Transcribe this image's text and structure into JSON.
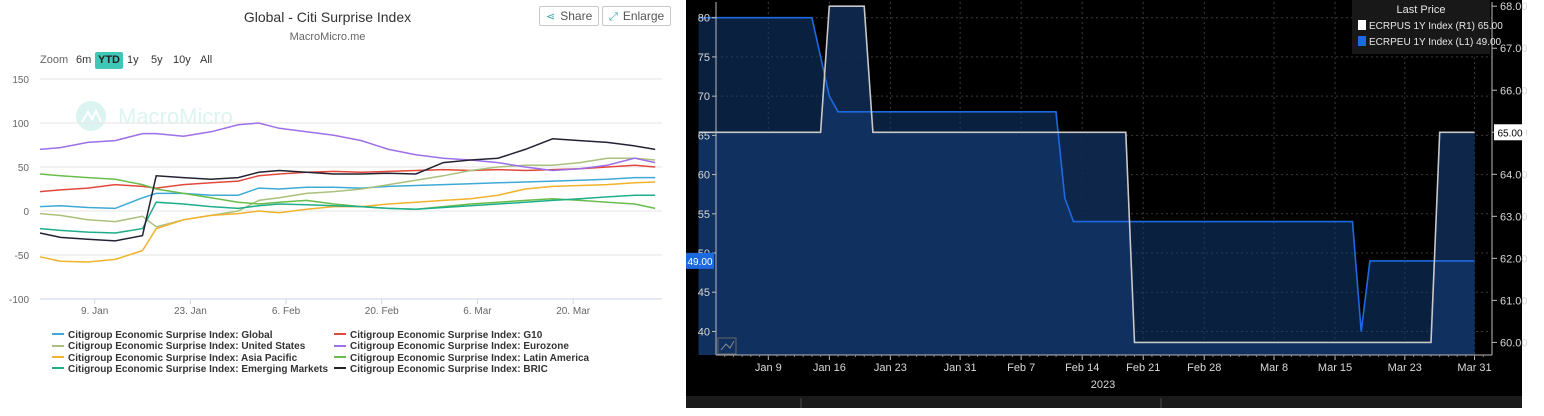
{
  "left_chart": {
    "title": "Global - Citi Surprise Index",
    "subtitle": "MacroMicro.me",
    "watermark": "MacroMicro",
    "share_label": "Share",
    "enlarge_label": "Enlarge",
    "zoom_label": "Zoom",
    "zoom_options": [
      "6m",
      "YTD",
      "1y",
      "5y",
      "10y",
      "All"
    ],
    "zoom_selected": "YTD"
  },
  "right_chart": {
    "legend_header": "Last Price",
    "year_label": "2023",
    "left_badge": "49.00",
    "right_badge": "65.00"
  },
  "chart_data": [
    {
      "type": "line",
      "title": "Global - Citi Surprise Index",
      "x_type": "date",
      "x_ticks": [
        "9. Jan",
        "23. Jan",
        "6. Feb",
        "20. Feb",
        "6. Mar",
        "20. Mar"
      ],
      "x_tick_days": [
        9,
        23,
        37,
        51,
        65,
        79
      ],
      "ylim": [
        -100,
        150
      ],
      "y_ticks": [
        -100,
        -50,
        0,
        50,
        100,
        150
      ],
      "grid": true,
      "legend_position": "bottom",
      "x": [
        1,
        4,
        8,
        12,
        16,
        18,
        22,
        26,
        30,
        33,
        36,
        40,
        44,
        48,
        52,
        56,
        60,
        64,
        68,
        72,
        76,
        80,
        84,
        88,
        91
      ],
      "series": [
        {
          "name": "Citigroup Economic Surprise Index: Global",
          "color": "#3fa9d6",
          "values": [
            5,
            6,
            4,
            3,
            15,
            20,
            20,
            18,
            18,
            26,
            25,
            27,
            27,
            26,
            28,
            29,
            30,
            31,
            32,
            33,
            34,
            35,
            36,
            38,
            38
          ]
        },
        {
          "name": "Citigroup Economic Surprise Index: G10",
          "color": "#e2483b",
          "values": [
            22,
            24,
            26,
            30,
            28,
            26,
            30,
            32,
            34,
            40,
            42,
            44,
            45,
            44,
            45,
            46,
            47,
            46,
            47,
            46,
            47,
            48,
            50,
            52,
            50
          ]
        },
        {
          "name": "Citigroup Economic Surprise Index: United States",
          "color": "#aac07d",
          "values": [
            -3,
            -5,
            -10,
            -12,
            -6,
            -18,
            -10,
            -5,
            0,
            12,
            15,
            20,
            22,
            25,
            30,
            35,
            40,
            46,
            50,
            52,
            52,
            55,
            60,
            60,
            58
          ]
        },
        {
          "name": "Citigroup Economic Surprise Index: Eurozone",
          "color": "#9d6fe8",
          "values": [
            70,
            72,
            78,
            80,
            88,
            88,
            85,
            90,
            98,
            100,
            94,
            90,
            86,
            80,
            70,
            64,
            60,
            58,
            55,
            50,
            46,
            48,
            52,
            60,
            55
          ]
        },
        {
          "name": "Citigroup Economic Surprise Index: Asia Pacific",
          "color": "#f1b22c",
          "values": [
            -52,
            -57,
            -58,
            -55,
            -45,
            -20,
            -10,
            -5,
            -3,
            0,
            -2,
            2,
            5,
            5,
            8,
            10,
            12,
            14,
            18,
            25,
            28,
            29,
            30,
            32,
            33
          ]
        },
        {
          "name": "Citigroup Economic Surprise Index: Latin America",
          "color": "#69bd4a",
          "values": [
            42,
            40,
            38,
            36,
            30,
            25,
            20,
            15,
            10,
            8,
            10,
            12,
            8,
            5,
            3,
            2,
            5,
            8,
            10,
            12,
            14,
            12,
            10,
            8,
            3
          ]
        },
        {
          "name": "Citigroup Economic Surprise Index: Emerging Markets",
          "color": "#1fae8c",
          "values": [
            -20,
            -22,
            -24,
            -25,
            -20,
            10,
            8,
            5,
            3,
            6,
            8,
            7,
            6,
            5,
            3,
            2,
            4,
            6,
            8,
            10,
            12,
            14,
            16,
            18,
            18
          ]
        },
        {
          "name": "Citigroup Economic Surprise Index: BRIC",
          "color": "#222233",
          "values": [
            -25,
            -30,
            -32,
            -34,
            -28,
            40,
            38,
            36,
            38,
            44,
            46,
            44,
            42,
            42,
            43,
            42,
            55,
            58,
            60,
            70,
            82,
            80,
            78,
            74,
            70
          ]
        }
      ]
    },
    {
      "type": "line",
      "title": "",
      "x_type": "date",
      "x_ticks": [
        "Jan 9",
        "Jan 16",
        "Jan 23",
        "Jan 31",
        "Feb 7",
        "Feb 14",
        "Feb 21",
        "Feb 28",
        "Mar 8",
        "Mar 15",
        "Mar 23",
        "Mar 31"
      ],
      "x_tick_days": [
        9,
        16,
        23,
        31,
        38,
        45,
        52,
        59,
        67,
        74,
        82,
        90
      ],
      "y_left_ticks": [
        40,
        45,
        50,
        55,
        60,
        65,
        70,
        75,
        80
      ],
      "y_left_lim": [
        37,
        82
      ],
      "y_right_ticks": [
        "60.00",
        "61.00",
        "62.00",
        "63.00",
        "64.00",
        "65.00",
        "66.00",
        "67.00",
        "68.00"
      ],
      "y_right_lim": [
        59.7,
        68.1
      ],
      "grid": true,
      "legend_position": "top-right",
      "series": [
        {
          "name": "ECRPUS 1Y Index (R1) 65.00",
          "color": "#ffffff",
          "axis": "right",
          "x": [
            1,
            15,
            16,
            20,
            21,
            50,
            51,
            85,
            86,
            90
          ],
          "values": [
            65,
            65,
            68,
            68,
            65,
            65,
            60,
            60,
            65,
            65
          ]
        },
        {
          "name": "ECRPEU 1Y Index (L1) 49.00",
          "color": "#1d6ae0",
          "axis": "left",
          "x": [
            1,
            14,
            16,
            17,
            42,
            43,
            44,
            76,
            77,
            78,
            90
          ],
          "values": [
            80,
            80,
            70,
            68,
            68,
            57,
            54,
            54,
            40,
            49,
            49
          ]
        }
      ]
    }
  ]
}
